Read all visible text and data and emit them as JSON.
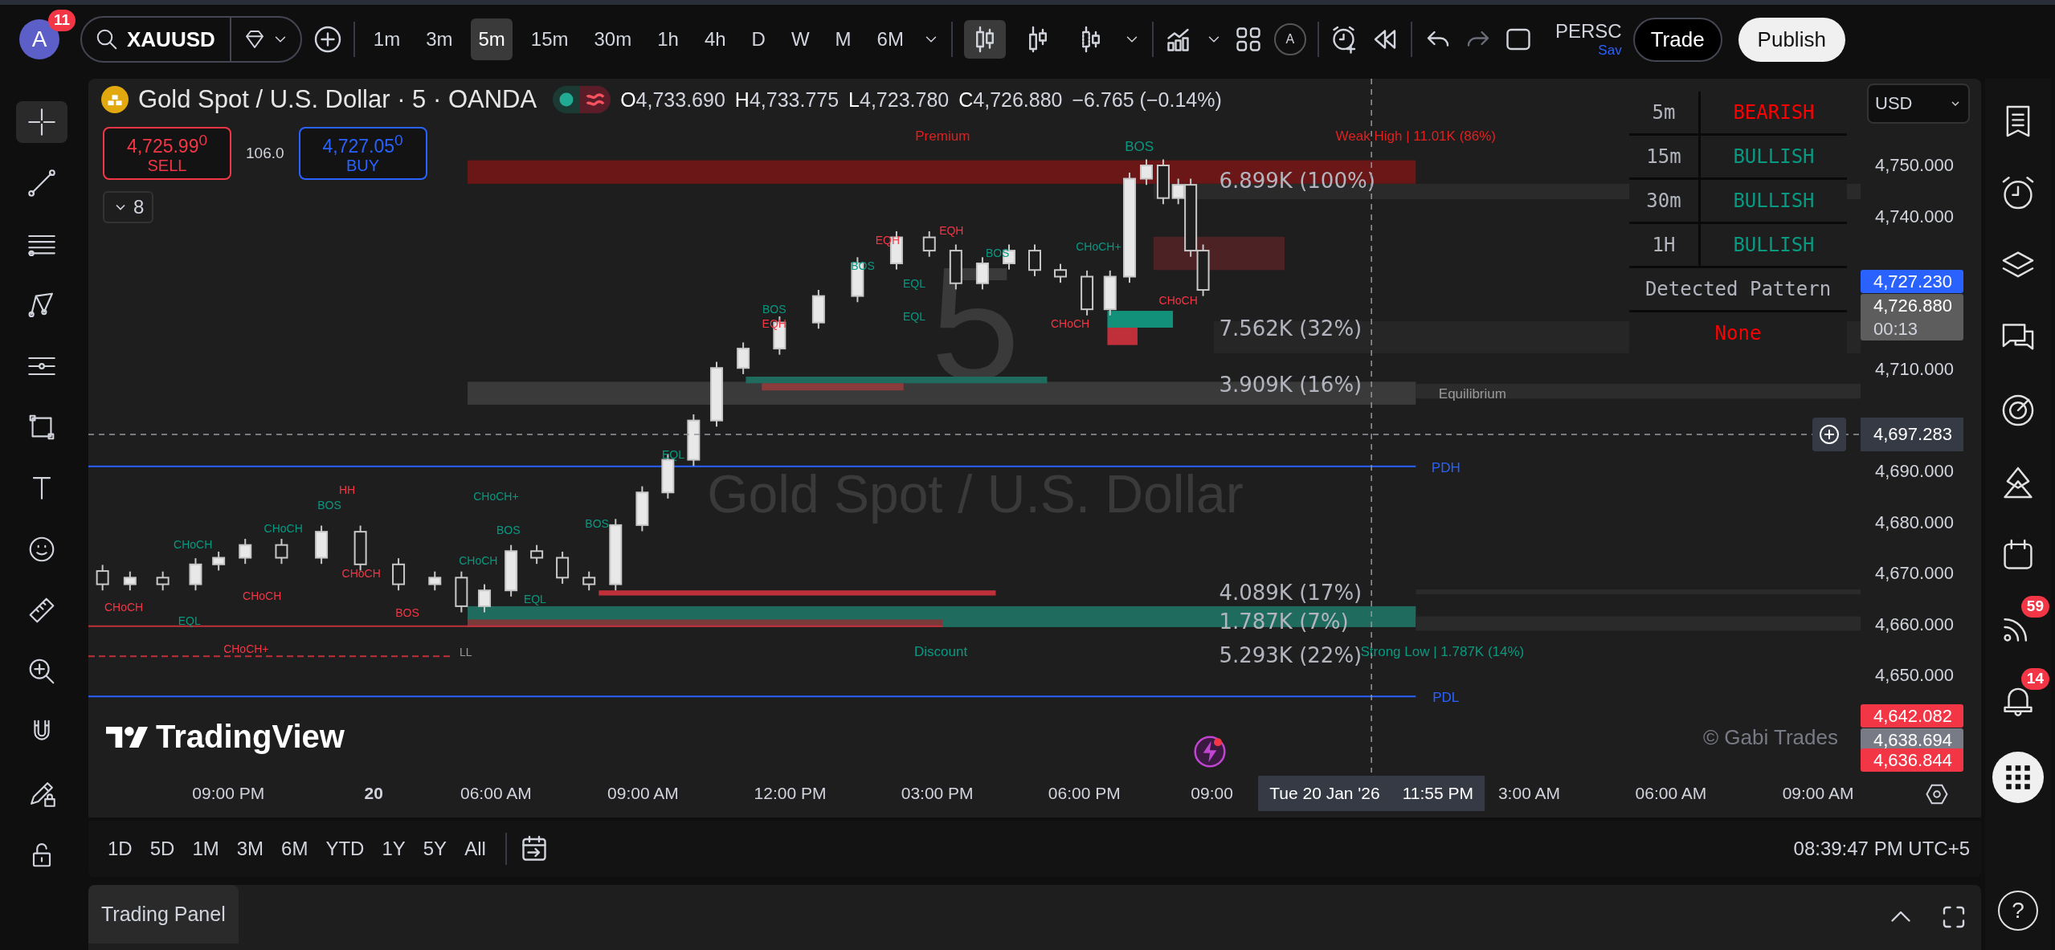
{
  "top_bar": {
    "avatar": "A",
    "avatar_badge": "11",
    "symbol": "XAUUSD",
    "intervals": [
      {
        "label": "1m",
        "selected": false
      },
      {
        "label": "3m",
        "selected": false
      },
      {
        "label": "5m",
        "selected": true
      },
      {
        "label": "15m",
        "selected": false
      },
      {
        "label": "30m",
        "selected": false
      },
      {
        "label": "1h",
        "selected": false
      },
      {
        "label": "4h",
        "selected": false
      },
      {
        "label": "D",
        "selected": false
      },
      {
        "label": "W",
        "selected": false
      },
      {
        "label": "M",
        "selected": false
      },
      {
        "label": "6M",
        "selected": false
      }
    ],
    "chart_types": [
      {
        "kind": "candles",
        "selected": true
      },
      {
        "kind": "bars",
        "selected": false
      },
      {
        "kind": "hollow",
        "selected": false
      }
    ],
    "alert_letter": "A",
    "layout": {
      "name": "PERSC",
      "status": "Sav"
    },
    "trade": "Trade",
    "publish": "Publish"
  },
  "left_toolbar": {
    "tools": [
      {
        "kind": "crosshair",
        "selected": true
      },
      {
        "kind": "trendline",
        "selected": false
      },
      {
        "kind": "fib",
        "selected": false
      },
      {
        "kind": "pattern",
        "selected": false
      },
      {
        "kind": "projection",
        "selected": false
      },
      {
        "kind": "shapes",
        "selected": false
      },
      {
        "kind": "text",
        "selected": false
      },
      {
        "kind": "emoji",
        "selected": false
      },
      {
        "kind": "ruler",
        "selected": false
      },
      {
        "kind": "zoom",
        "selected": false
      },
      {
        "kind": "magnet",
        "selected": false
      },
      {
        "kind": "drawlock",
        "selected": false
      },
      {
        "kind": "lock",
        "selected": false
      }
    ]
  },
  "chart": {
    "title": "Gold Spot / U.S. Dollar · 5 · OANDA",
    "ohlc": [
      {
        "key": "O",
        "value": "4,733.690"
      },
      {
        "key": "H",
        "value": "4,733.775"
      },
      {
        "key": "L",
        "value": "4,723.780"
      },
      {
        "key": "C",
        "value": "4,726.880"
      }
    ],
    "change": "−6.765 (−0.14%)",
    "sell": {
      "price": "4,725.99$^{0}$",
      "label": "SELL"
    },
    "spread": "106.0",
    "buy": {
      "price": "4,727.05$^{0}$",
      "label": "BUY"
    },
    "indicators_count": "8",
    "watermark": {
      "interval": "5",
      "name": "Gold Spot / U.S. Dollar"
    },
    "logo": "TradingView",
    "credit": "© Gabi Trades",
    "currency": "USD",
    "table": {
      "rows": [
        {
          "tf": "5m",
          "trend": "BEARISH",
          "color": "#ff0000"
        },
        {
          "tf": "15m",
          "trend": "BULLISH",
          "color": "#089981"
        },
        {
          "tf": "30m",
          "trend": "BULLISH",
          "color": "#089981"
        },
        {
          "tf": "1H",
          "trend": "BULLISH",
          "color": "#089981"
        }
      ],
      "pattern_title": "Detected Pattern",
      "pattern": "None"
    },
    "labels": [
      {
        "text": "Premium",
        "color": "#e0201f"
      },
      {
        "text": "Weak High | 11.01K (86%)",
        "color": "#e0201f"
      },
      {
        "text": "BOS",
        "color": "#089981"
      },
      {
        "text": "Equilibrium",
        "color": "#9a9a9a"
      },
      {
        "text": "PDH",
        "color": "#2962ff"
      },
      {
        "text": "PDL",
        "color": "#2962ff"
      },
      {
        "text": "Discount",
        "color": "#089981"
      },
      {
        "text": "Strong Low | 1.787K (14%)",
        "color": "#089981"
      },
      {
        "text": "BOS",
        "color": "#089981"
      },
      {
        "text": "EQH",
        "color": "#f23645"
      },
      {
        "text": "BOS",
        "color": "#089981"
      },
      {
        "text": "EQH",
        "color": "#f23645"
      },
      {
        "text": "EQH",
        "color": "#f23645"
      },
      {
        "text": "EQL",
        "color": "#089981"
      },
      {
        "text": "BOS",
        "color": "#089981"
      },
      {
        "text": "EQL",
        "color": "#089981"
      },
      {
        "text": "CHoCH+",
        "color": "#089981"
      },
      {
        "text": "CHoCH",
        "color": "#f23645"
      },
      {
        "text": "CHoCH",
        "color": "#f23645"
      },
      {
        "text": "EQL",
        "color": "#089981"
      },
      {
        "text": "BOS",
        "color": "#089981"
      },
      {
        "text": "HH",
        "color": "#f23645"
      },
      {
        "text": "CHoCH+",
        "color": "#089981"
      },
      {
        "text": "BOS",
        "color": "#089981"
      },
      {
        "text": "BOS",
        "color": "#089981"
      },
      {
        "text": "CHoCH",
        "color": "#089981"
      },
      {
        "text": "CHoCH",
        "color": "#089981"
      },
      {
        "text": "CHoCH",
        "color": "#f23645"
      },
      {
        "text": "CHoCH",
        "color": "#f23645"
      },
      {
        "text": "CHoCH",
        "color": "#089981"
      },
      {
        "text": "BOS",
        "color": "#f23645"
      },
      {
        "text": "CHoCH",
        "color": "#f23645"
      },
      {
        "text": "CHoCH+",
        "color": "#f23645"
      },
      {
        "text": "LL",
        "color": "#9a9a9a"
      },
      {
        "text": "EQL",
        "color": "#089981"
      },
      {
        "text": "EQL",
        "color": "#089981"
      }
    ],
    "volume_labels": [
      "6.899K (100%)",
      "7.562K (32%)",
      "3.909K (16%)",
      "4.089K (17%)",
      "1.787K (7%)",
      "5.293K (22%)"
    ],
    "price_ticks": [
      "4,750.000",
      "4,740.000",
      "4,710.000",
      "4,690.000",
      "4,680.000",
      "4,670.000",
      "4,660.000",
      "4,650.000"
    ],
    "price_tags": [
      {
        "label": "4,727.230",
        "color": "#2962ff"
      },
      {
        "label": "4,726.880",
        "sublabel": "00:13",
        "color": "#5d5d5d"
      },
      {
        "label": "4,642.082",
        "color": "#f23645"
      },
      {
        "label": "4,638.694",
        "color": "#787b86"
      },
      {
        "label": "4,636.844",
        "color": "#f23645"
      }
    ],
    "time_ticks": [
      "09:00 PM",
      "20",
      "06:00 AM",
      "09:00 AM",
      "12:00 PM",
      "03:00 PM",
      "06:00 PM",
      "09:00",
      "3:00 AM",
      "06:00 AM",
      "09:00 AM"
    ],
    "crosshair": {
      "price": "4,697.283",
      "date": "Tue 20 Jan '26",
      "time": "11:55 PM"
    }
  },
  "range_bar": {
    "ranges": [
      "1D",
      "5D",
      "1M",
      "3M",
      "6M",
      "YTD",
      "1Y",
      "5Y",
      "All"
    ],
    "clock": "08:39:47 PM UTC+5"
  },
  "trading_panel": {
    "title": "Trading Panel"
  },
  "right_sidebar": {
    "items": [
      {
        "kind": "watchlist"
      },
      {
        "kind": "alerts"
      },
      {
        "kind": "layers"
      },
      {
        "kind": "chat"
      },
      {
        "kind": "target"
      },
      {
        "kind": "ideas"
      },
      {
        "kind": "calendar"
      },
      {
        "kind": "feed",
        "badge": "59"
      },
      {
        "kind": "notifications",
        "badge": "14"
      },
      {
        "kind": "apps"
      }
    ],
    "help": "?"
  }
}
